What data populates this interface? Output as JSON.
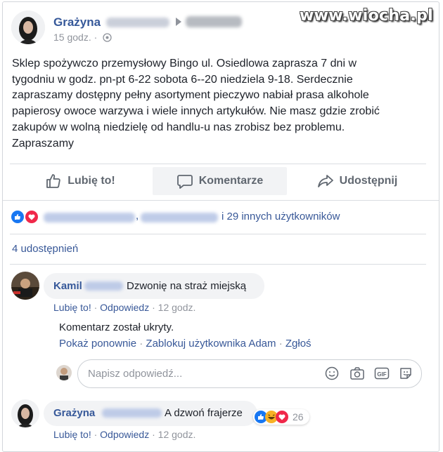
{
  "watermark": "www.wiocha.pl",
  "post": {
    "author": "Grażyna",
    "time": "15 godz.",
    "separator": "·",
    "text_lines": [
      "Sklep spożywczo przemysłowy Bingo ul. Osiedlowa zaprasza 7 dni w",
      "tygodniu w godz. pn-pt 6-22 sobota 6--20 niedziela 9-18. Serdecznie",
      "zapraszamy dostępny pełny asortyment pieczywo nabiał prasa alkohole",
      "papierosy owoce warzywa i wiele innych artykułów. Nie masz gdzie zrobić",
      "zakupów w wolną niedzielę od handlu-u nas zrobisz bez problemu.",
      "Zapraszamy"
    ]
  },
  "actions": {
    "like": "Lubię to!",
    "comment": "Komentarze",
    "share": "Udostępnij"
  },
  "reactions": {
    "comma": ",",
    "others": "i 29 innych użytkowników"
  },
  "shares": "4 udostępnień",
  "comments": [
    {
      "author": "Kamil",
      "text": "Dzwonię na straż miejską",
      "like": "Lubię to!",
      "reply": "Odpowiedz",
      "time": "12 godz."
    },
    {
      "author": "Grażyna",
      "text": "A dzwoń frajerze",
      "reaction_count": "26",
      "like": "Lubię to!",
      "reply": "Odpowiedz",
      "time": "12 godz."
    }
  ],
  "hidden": {
    "message": "Komentarz został ukryty.",
    "show_again": "Pokaż ponownie",
    "block": "Zablokuj użytkownika Adam",
    "report": "Zgłoś"
  },
  "reply_box": {
    "placeholder": "Napisz odpowiedź..."
  },
  "dot": "·",
  "colors": {
    "link": "#385898",
    "like_blue": "#1877f2",
    "love_red": "#f0284a"
  }
}
